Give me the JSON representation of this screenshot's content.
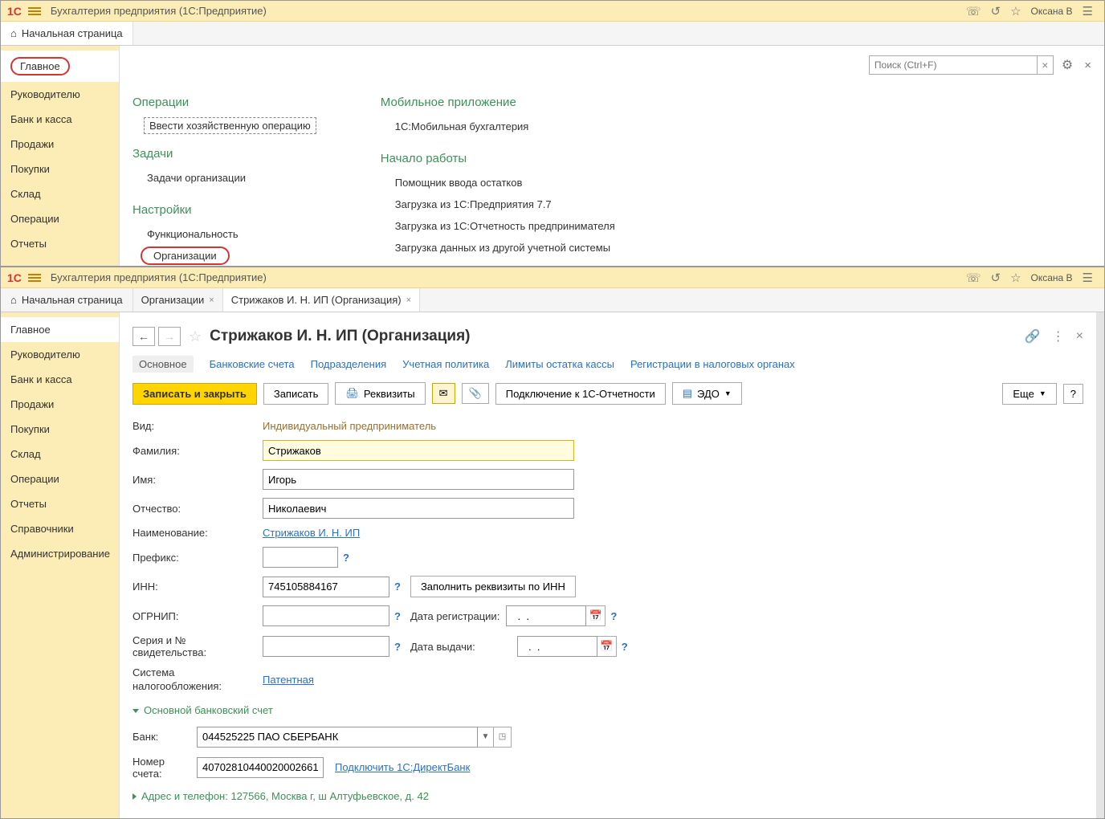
{
  "app_title": "Бухгалтерия предприятия  (1С:Предприятие)",
  "user": "Оксана В",
  "tabs1": {
    "home": "Начальная страница"
  },
  "search_placeholder": "Поиск (Ctrl+F)",
  "sidebar1": {
    "items": [
      "Главное",
      "Руководителю",
      "Банк и касса",
      "Продажи",
      "Покупки",
      "Склад",
      "Операции",
      "Отчеты"
    ]
  },
  "groups1": {
    "col1": {
      "h1": "Операции",
      "i1": "Ввести хозяйственную операцию",
      "h2": "Задачи",
      "i2": "Задачи организации",
      "h3": "Настройки",
      "i3": "Функциональность",
      "i4": "Организации"
    },
    "col2": {
      "h1": "Мобильное приложение",
      "i1": "1С:Мобильная бухгалтерия",
      "h2": "Начало работы",
      "i2": "Помощник ввода остатков",
      "i3": "Загрузка из 1С:Предприятия 7.7",
      "i4": "Загрузка из 1С:Отчетность предпринимателя",
      "i5": "Загрузка данных из другой учетной системы"
    }
  },
  "tabs2": {
    "home": "Начальная страница",
    "t1": "Организации",
    "t2": "Стрижаков И. Н. ИП (Организация)"
  },
  "sidebar2": {
    "items": [
      "Главное",
      "Руководителю",
      "Банк и касса",
      "Продажи",
      "Покупки",
      "Склад",
      "Операции",
      "Отчеты",
      "Справочники",
      "Администрирование"
    ]
  },
  "page": {
    "title": "Стрижаков И. Н. ИП (Организация)",
    "subnav": [
      "Основное",
      "Банковские счета",
      "Подразделения",
      "Учетная политика",
      "Лимиты остатка кассы",
      "Регистрации в налоговых органах"
    ],
    "toolbar": {
      "save_close": "Записать и закрыть",
      "save": "Записать",
      "details": "Реквизиты",
      "connect": "Подключение к 1С-Отчетности",
      "edo": "ЭДО",
      "more": "Еще",
      "q": "?"
    },
    "form": {
      "vid_l": "Вид:",
      "vid_v": "Индивидуальный предприниматель",
      "fam_l": "Фамилия:",
      "fam_v": "Стрижаков",
      "name_l": "Имя:",
      "name_v": "Игорь",
      "otch_l": "Отчество:",
      "otch_v": "Николаевич",
      "naim_l": "Наименование:",
      "naim_v": "Стрижаков И. Н. ИП",
      "pref_l": "Префикс:",
      "pref_v": "",
      "inn_l": "ИНН:",
      "inn_v": "745105884167",
      "inn_btn": "Заполнить реквизиты по ИНН",
      "ogrnip_l": "ОГРНИП:",
      "ogrnip_v": "",
      "datereg_l": "Дата регистрации:",
      "datereg_v": "  .  .    ",
      "ser_l": "Серия и № свидетельства:",
      "ser_v": "",
      "dateiss_l": "Дата выдачи:",
      "dateiss_v": "  .  .    ",
      "tax_l": "Система налогообложения:",
      "tax_v": "Патентная",
      "exp1": "Основной банковский счет",
      "bank_l": "Банк:",
      "bank_v": "044525225 ПАО СБЕРБАНК",
      "acc_l": "Номер счета:",
      "acc_v": "40702810440020002661",
      "acc_link": "Подключить 1С:ДиректБанк",
      "exp2": "Адрес и телефон: 127566, Москва г, ш Алтуфьевское, д. 42"
    }
  }
}
